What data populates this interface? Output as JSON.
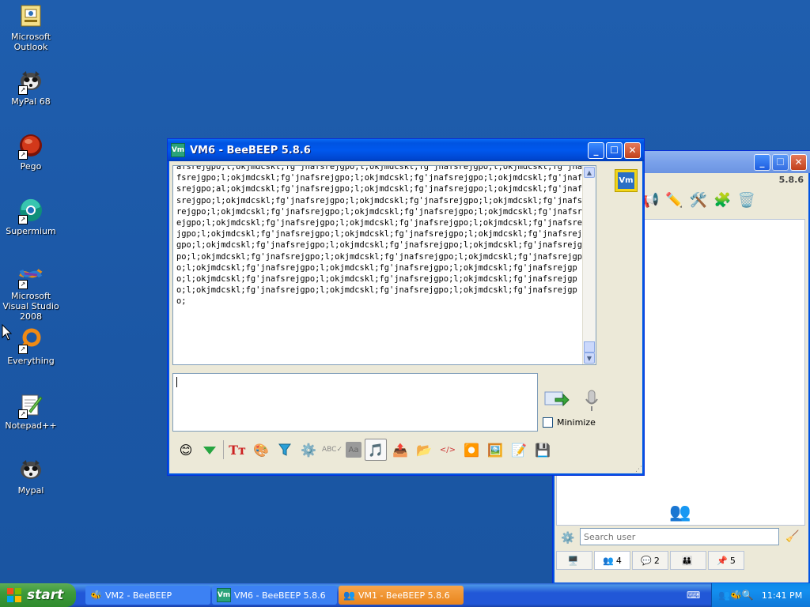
{
  "desktop": {
    "icons": [
      {
        "label": "Microsoft Outlook",
        "icon": "outlook-icon"
      },
      {
        "label": "MyPal 68",
        "icon": "raccoon-icon"
      },
      {
        "label": "Pego",
        "icon": "pego-icon"
      },
      {
        "label": "Supermium",
        "icon": "supermium-icon"
      },
      {
        "label": "Microsoft Visual Studio 2008",
        "icon": "visual-studio-icon"
      },
      {
        "label": "Everything",
        "icon": "everything-icon"
      },
      {
        "label": "Notepad++",
        "icon": "notepadpp-icon"
      },
      {
        "label": "Mypal",
        "icon": "raccoon-icon"
      }
    ]
  },
  "chat_window": {
    "title": "VM6 - BeeBEEP 5.8.6",
    "app_badge": "Vm",
    "log_text": "afsrejgpo;l;okjmdcskl;fg'jnafsrejgpo;l;okjmdcskl;fg'jnafsrejgpo;l;okjmdcskl;fg'jnafsrejgpo;l;okjmdcskl;fg'jnafsrejgpo;l;okjmdcskl;fg'jnafsrejgpo;l;okjmdcskl;fg'jnafsrejgpo;al;okjmdcskl;fg'jnafsrejgpo;l;okjmdcskl;fg'jnafsrejgpo;l;okjmdcskl;fg'jnafsrejgpo;l;okjmdcskl;fg'jnafsrejgpo;l;okjmdcskl;fg'jnafsrejgpo;l;okjmdcskl;fg'jnafsrejgpo;l;okjmdcskl;fg'jnafsrejgpo;l;okjmdcskl;fg'jnafsrejgpo;l;okjmdcskl;fg'jnafsrejgpo;l;okjmdcskl;fg'jnafsrejgpo;l;okjmdcskl;fg'jnafsrejgpo;l;okjmdcskl;fg'jnafsrejgpo;l;okjmdcskl;fg'jnafsrejgpo;l;okjmdcskl;fg'jnafsrejgpo;l;okjmdcskl;fg'jnafsrejgpo;l;okjmdcskl;fg'jnafsrejgpo;l;okjmdcskl;fg'jnafsrejgpo;l;okjmdcskl;fg'jnafsrejgpo;l;okjmdcskl;fg'jnafsrejgpo;l;okjmdcskl;fg'jnafsrejgpo;l;okjmdcskl;fg'jnafsrejgpo;l;okjmdcskl;fg'jnafsrejgpo;l;okjmdcskl;fg'jnafsrejgpo;l;okjmdcskl;fg'jnafsrejgpo;l;okjmdcskl;fg'jnafsrejgpo;l;okjmdcskl;fg'jnafsrejgpo;l;okjmdcskl;fg'jnafsrejgpo;l;okjmdcskl;fg'jnafsrejgpo;l;okjmdcskl;fg'jnafsrejgpo;l;okjmdcskl;fg'jnafsrejgpo;",
    "input_value": "",
    "minimize_label": "Minimize",
    "minimize_checked": false,
    "toolbar_icons": [
      "emoticon-icon",
      "send-file-down-icon",
      "font-icon",
      "color-palette-icon",
      "filter-icon",
      "settings-gear-icon",
      "spellcheck-icon",
      "dictionary-icon",
      "music-note-icon",
      "export-icon",
      "forward-icon",
      "html-icon",
      "record-icon",
      "screenshot-icon",
      "notes-icon",
      "save-icon"
    ]
  },
  "main_window": {
    "version": "5.8.6",
    "search_placeholder": "Search user",
    "tabs": [
      {
        "icon": "monitor-icon",
        "count": ""
      },
      {
        "icon": "users-icon",
        "count": "4"
      },
      {
        "icon": "chats-icon",
        "count": "2"
      },
      {
        "icon": "groups-icon",
        "count": ""
      },
      {
        "icon": "pin-icon",
        "count": "5"
      }
    ]
  },
  "taskbar": {
    "start_label": "start",
    "tasks": [
      {
        "label": "VM2 - BeeBEEP",
        "active": false
      },
      {
        "label": "VM6 - BeeBEEP 5.8.6",
        "active": false
      },
      {
        "label": "VM1 - BeeBEEP 5.8.6",
        "active": true
      }
    ],
    "clock": "11:41 PM"
  },
  "colors": {
    "xp_blue": "#0054e3",
    "desktop": "#1c5aa8",
    "task_active": "#f08a1c",
    "start_green": "#3c9a3a"
  }
}
